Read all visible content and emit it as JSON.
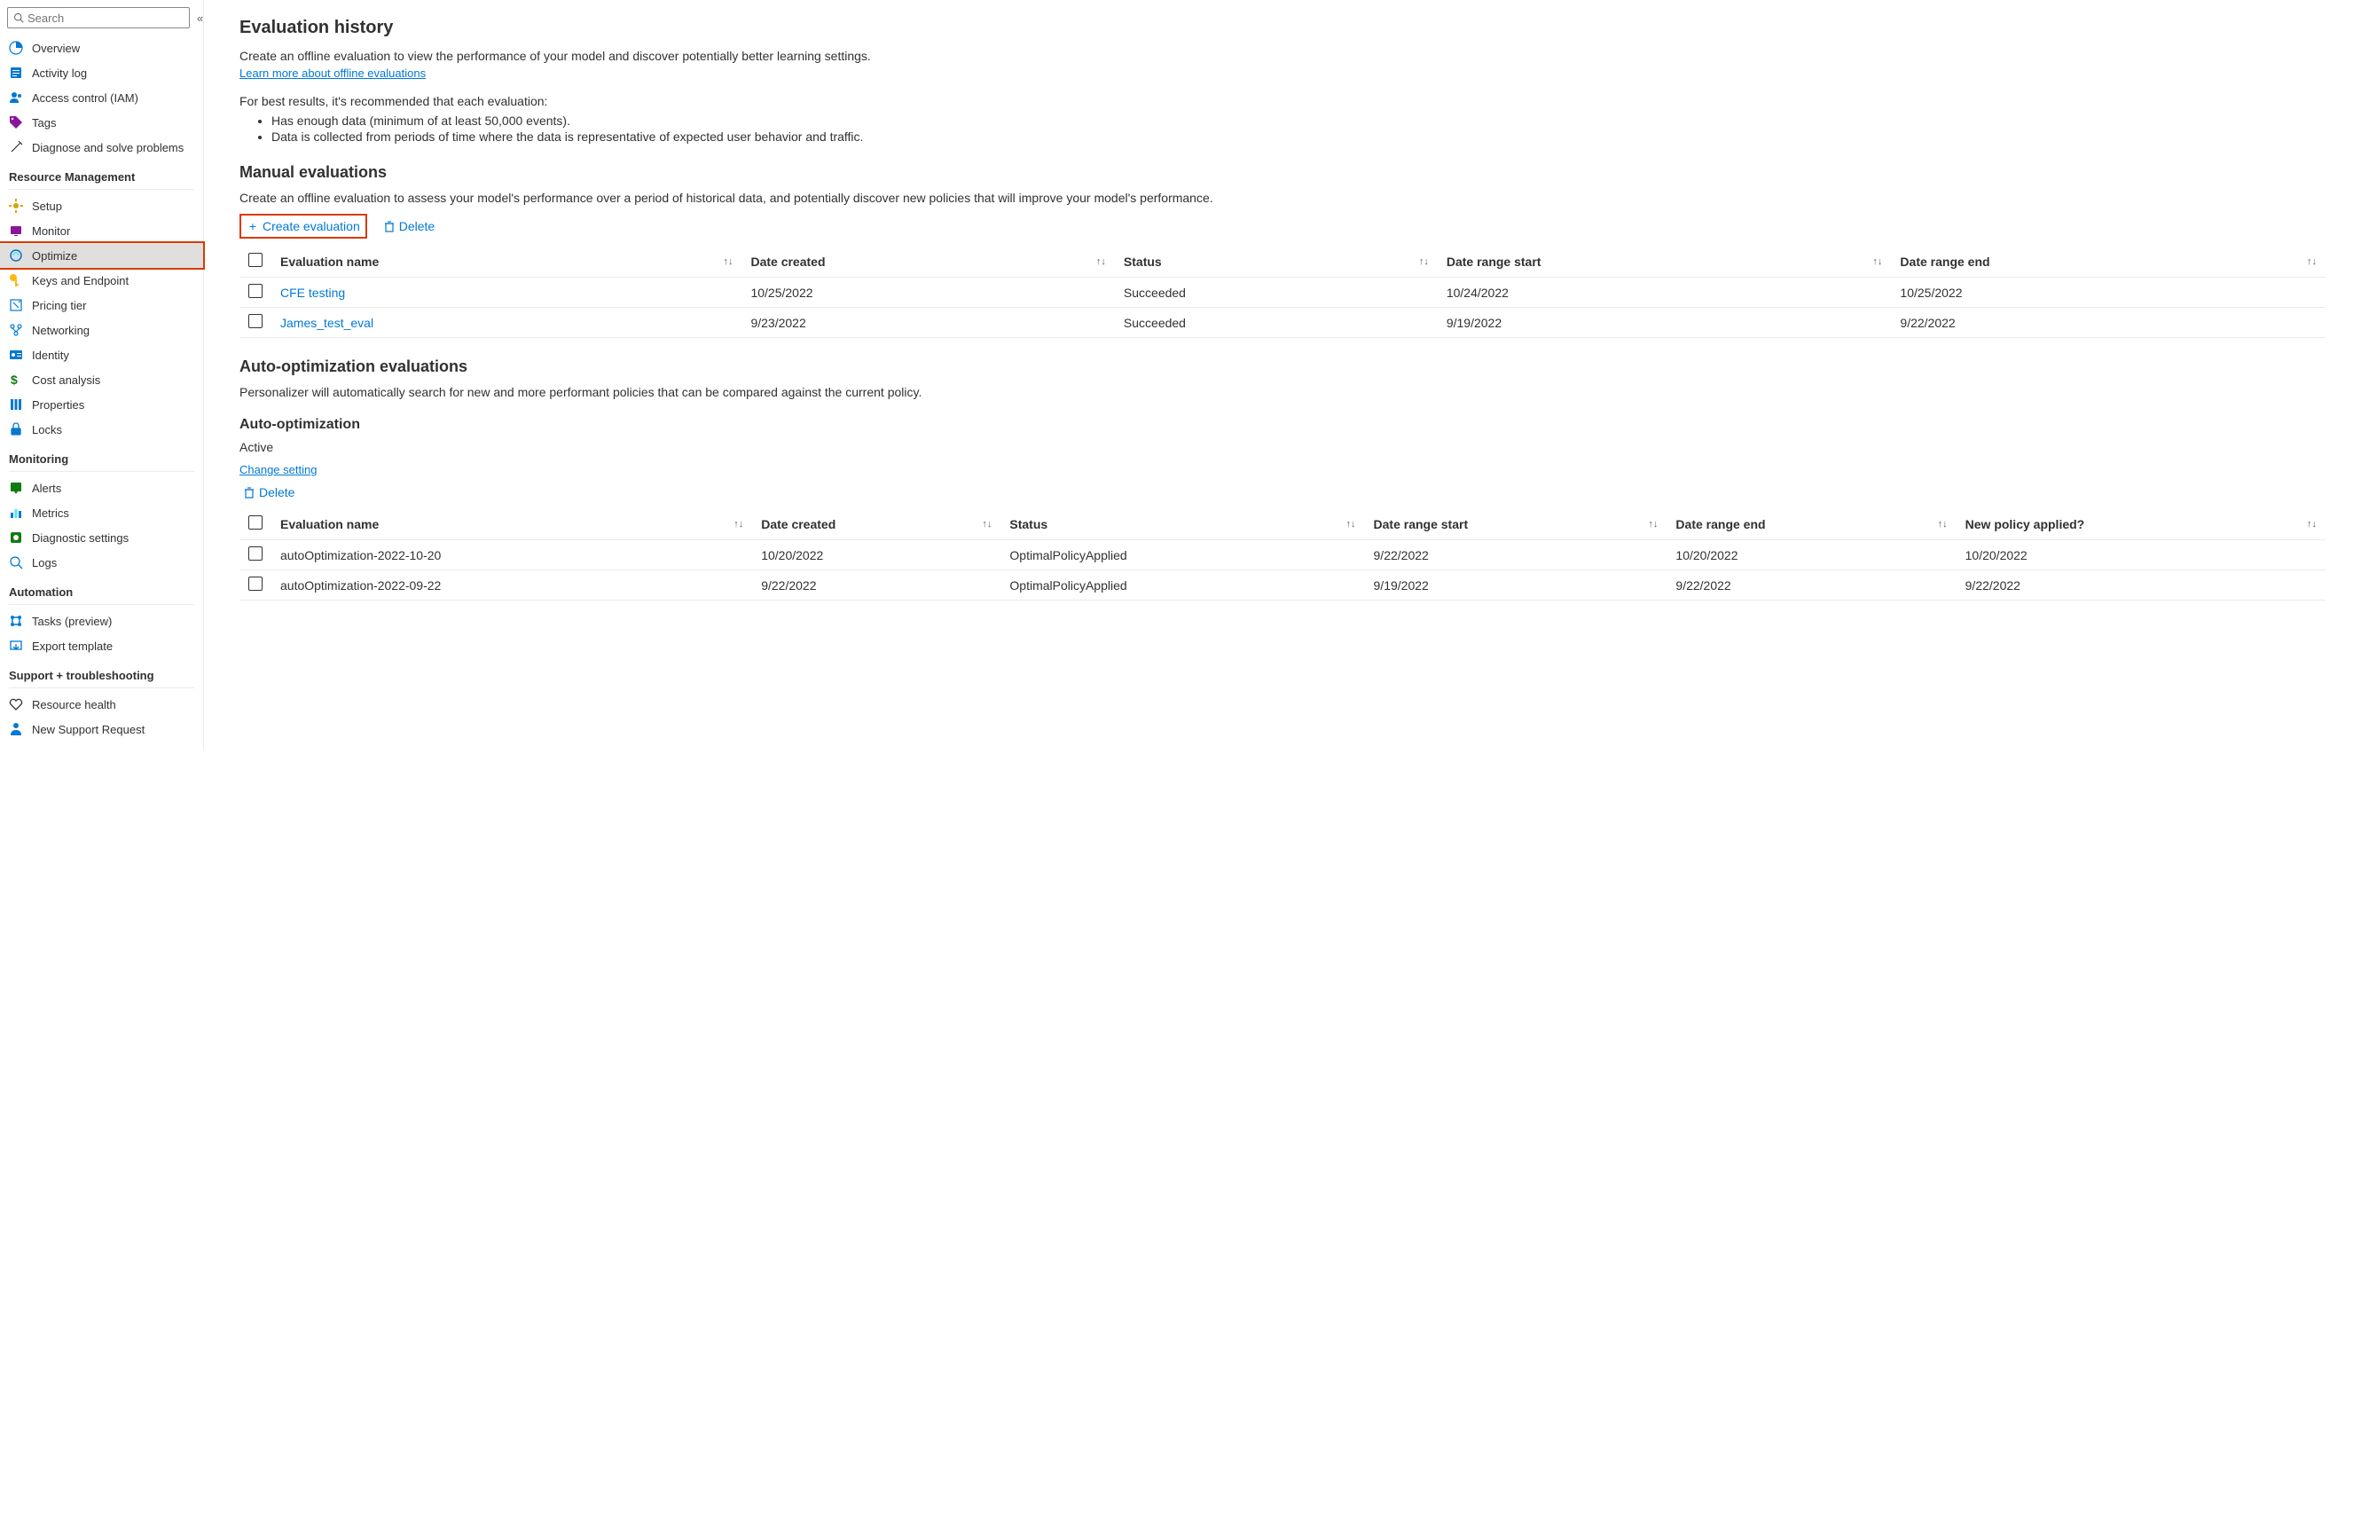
{
  "search": {
    "placeholder": "Search"
  },
  "sidebar": {
    "top": [
      {
        "label": "Overview"
      },
      {
        "label": "Activity log"
      },
      {
        "label": "Access control (IAM)"
      },
      {
        "label": "Tags"
      },
      {
        "label": "Diagnose and solve problems"
      }
    ],
    "sections": [
      {
        "title": "Resource Management",
        "items": [
          {
            "label": "Setup"
          },
          {
            "label": "Monitor"
          },
          {
            "label": "Optimize",
            "active": true
          },
          {
            "label": "Keys and Endpoint"
          },
          {
            "label": "Pricing tier"
          },
          {
            "label": "Networking"
          },
          {
            "label": "Identity"
          },
          {
            "label": "Cost analysis"
          },
          {
            "label": "Properties"
          },
          {
            "label": "Locks"
          }
        ]
      },
      {
        "title": "Monitoring",
        "items": [
          {
            "label": "Alerts"
          },
          {
            "label": "Metrics"
          },
          {
            "label": "Diagnostic settings"
          },
          {
            "label": "Logs"
          }
        ]
      },
      {
        "title": "Automation",
        "items": [
          {
            "label": "Tasks (preview)"
          },
          {
            "label": "Export template"
          }
        ]
      },
      {
        "title": "Support + troubleshooting",
        "items": [
          {
            "label": "Resource health"
          },
          {
            "label": "New Support Request"
          }
        ]
      }
    ]
  },
  "page": {
    "title": "Evaluation history",
    "intro": "Create an offline evaluation to view the performance of your model and discover potentially better learning settings.",
    "learnMore": "Learn more about offline evaluations",
    "recIntro": "For best results, it's recommended that each evaluation:",
    "recs": [
      "Has enough data (minimum of at least 50,000 events).",
      "Data is collected from periods of time where the data is representative of expected user behavior and traffic."
    ],
    "manual": {
      "title": "Manual evaluations",
      "desc": "Create an offline evaluation to assess your model's performance over a period of historical data, and potentially discover new policies that will improve your model's performance.",
      "createBtn": "Create evaluation",
      "deleteBtn": "Delete",
      "columns": [
        "Evaluation name",
        "Date created",
        "Status",
        "Date range start",
        "Date range end"
      ],
      "rows": [
        {
          "name": "CFE testing",
          "created": "10/25/2022",
          "status": "Succeeded",
          "start": "10/24/2022",
          "end": "10/25/2022"
        },
        {
          "name": "James_test_eval",
          "created": "9/23/2022",
          "status": "Succeeded",
          "start": "9/19/2022",
          "end": "9/22/2022"
        }
      ]
    },
    "autoOpt": {
      "title": "Auto-optimization evaluations",
      "desc": "Personalizer will automatically search for new and more performant policies that can be compared against the current policy.",
      "subTitle": "Auto-optimization",
      "status": "Active",
      "changeLink": "Change setting",
      "deleteBtn": "Delete",
      "columns": [
        "Evaluation name",
        "Date created",
        "Status",
        "Date range start",
        "Date range end",
        "New policy applied?"
      ],
      "rows": [
        {
          "name": "autoOptimization-2022-10-20",
          "created": "10/20/2022",
          "status": "OptimalPolicyApplied",
          "start": "9/22/2022",
          "end": "10/20/2022",
          "applied": "10/20/2022"
        },
        {
          "name": "autoOptimization-2022-09-22",
          "created": "9/22/2022",
          "status": "OptimalPolicyApplied",
          "start": "9/19/2022",
          "end": "9/22/2022",
          "applied": "9/22/2022"
        }
      ]
    }
  }
}
